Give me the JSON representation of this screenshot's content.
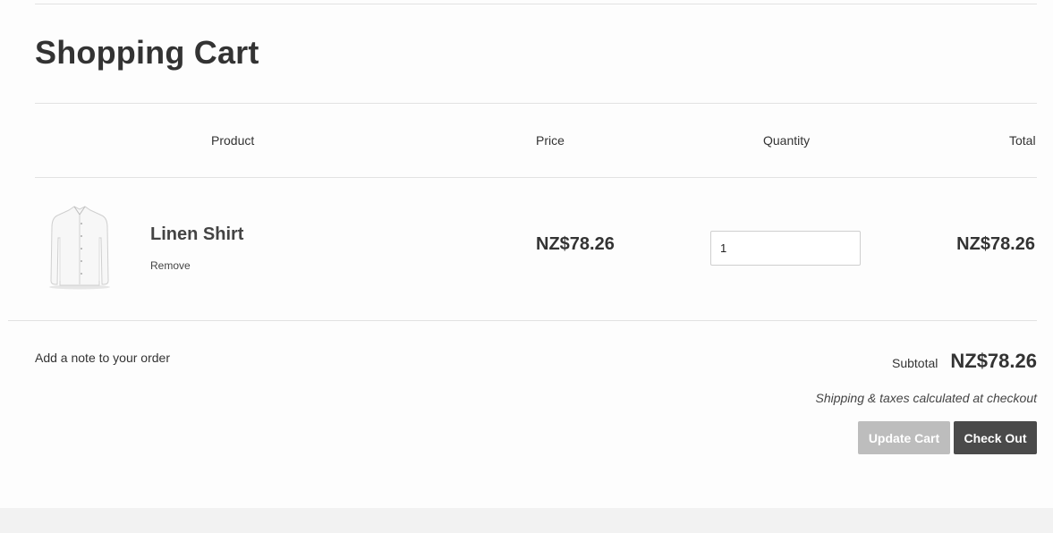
{
  "page": {
    "title": "Shopping Cart"
  },
  "table": {
    "headers": {
      "product": "Product",
      "price": "Price",
      "quantity": "Quantity",
      "total": "Total"
    }
  },
  "cart": {
    "items": [
      {
        "name": "Linen Shirt",
        "remove_label": "Remove",
        "price": "NZ$78.26",
        "quantity": "1",
        "total": "NZ$78.26",
        "image_icon": "shirt-icon"
      }
    ]
  },
  "summary": {
    "note_label": "Add a note to your order",
    "subtotal_label": "Subtotal",
    "subtotal_value": "NZ$78.26",
    "shipping_note": "Shipping & taxes calculated at checkout",
    "update_label": "Update Cart",
    "checkout_label": "Check Out"
  },
  "colors": {
    "update_button": "#bdbdbd",
    "checkout_button": "#4a4a4a",
    "footer_band": "#f2f2f2"
  }
}
